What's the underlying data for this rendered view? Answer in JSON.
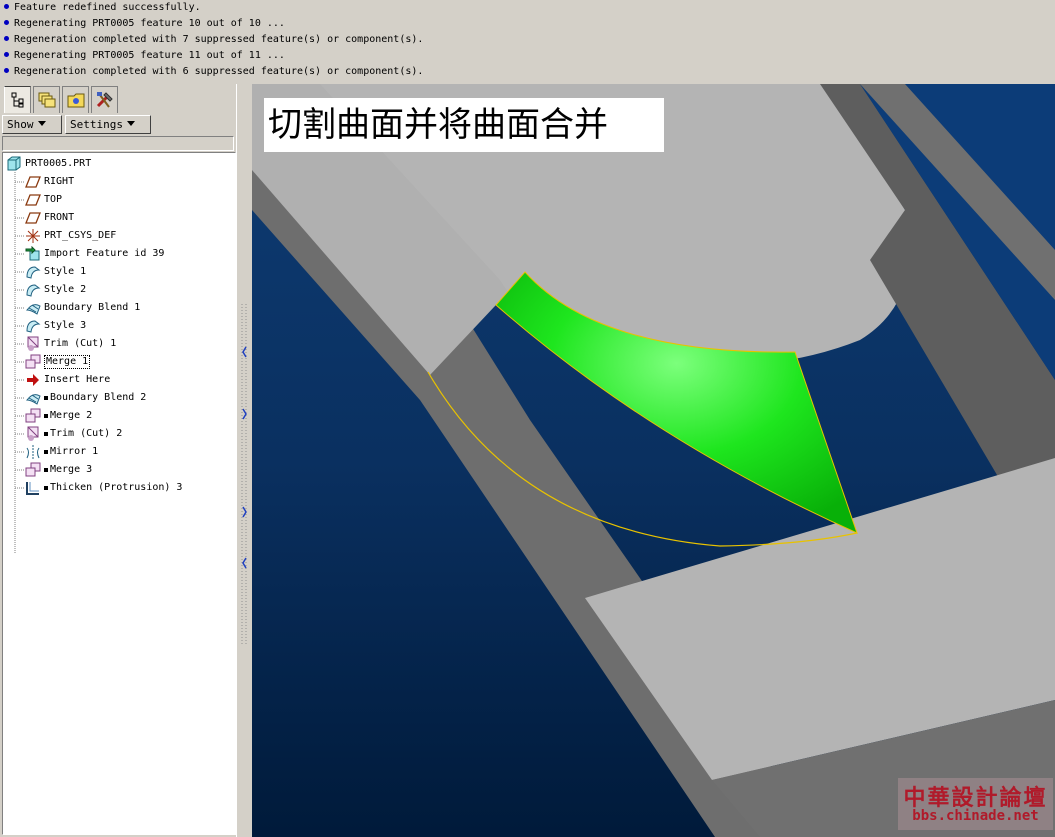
{
  "messages": [
    "Feature redefined successfully.",
    "Regenerating PRT0005 feature 10 out of 10 ...",
    "Regeneration completed with 7 suppressed feature(s) or component(s).",
    "Regenerating PRT0005 feature 11 out of 11 ...",
    "Regeneration completed with 6 suppressed feature(s) or component(s)."
  ],
  "tabs": [
    {
      "icon": "model-tree-icon",
      "active": true
    },
    {
      "icon": "layers-icon"
    },
    {
      "icon": "folder-browser-icon"
    },
    {
      "icon": "tools-icon"
    }
  ],
  "toolbar": {
    "show_label": "Show",
    "settings_label": "Settings"
  },
  "tree": {
    "root": "PRT0005.PRT",
    "items": [
      {
        "label": "RIGHT",
        "icon": "datum-plane-icon"
      },
      {
        "label": "TOP",
        "icon": "datum-plane-icon"
      },
      {
        "label": "FRONT",
        "icon": "datum-plane-icon"
      },
      {
        "label": "PRT_CSYS_DEF",
        "icon": "csys-icon"
      },
      {
        "label": "Import Feature id 39",
        "icon": "import-feature-icon"
      },
      {
        "label": "Style 1",
        "icon": "style-icon"
      },
      {
        "label": "Style 2",
        "icon": "style-icon"
      },
      {
        "label": "Boundary Blend 1",
        "icon": "boundary-blend-icon"
      },
      {
        "label": "Style 3",
        "icon": "style-icon"
      },
      {
        "label": "Trim (Cut) 1",
        "icon": "trim-icon"
      },
      {
        "label": "Merge 1",
        "icon": "merge-icon"
      },
      {
        "label": "Insert Here",
        "icon": "insert-here-arrow-icon"
      },
      {
        "label": "Boundary Blend 2",
        "icon": "boundary-blend-icon",
        "suppressed": true
      },
      {
        "label": "Merge 2",
        "icon": "merge-icon",
        "suppressed": true
      },
      {
        "label": "Trim (Cut) 2",
        "icon": "trim-icon",
        "suppressed": true
      },
      {
        "label": "Mirror 1",
        "icon": "mirror-icon",
        "suppressed": true
      },
      {
        "label": "Merge 3",
        "icon": "merge-icon",
        "suppressed": true
      },
      {
        "label": "Thicken (Protrusion) 3",
        "icon": "thicken-icon",
        "suppressed": true
      }
    ]
  },
  "caption": "切割曲面并将曲面合并",
  "watermark": {
    "title": "中華設計論壇",
    "url": "bbs.chinade.net"
  },
  "colors": {
    "background_top": "#0e3c74",
    "background_bottom": "#001a3a",
    "part_gray": "#b4b4b4",
    "part_side": "#6e6e6e",
    "highlight_surface": "#1ee61e",
    "edge_yellow": "#e8c200"
  }
}
